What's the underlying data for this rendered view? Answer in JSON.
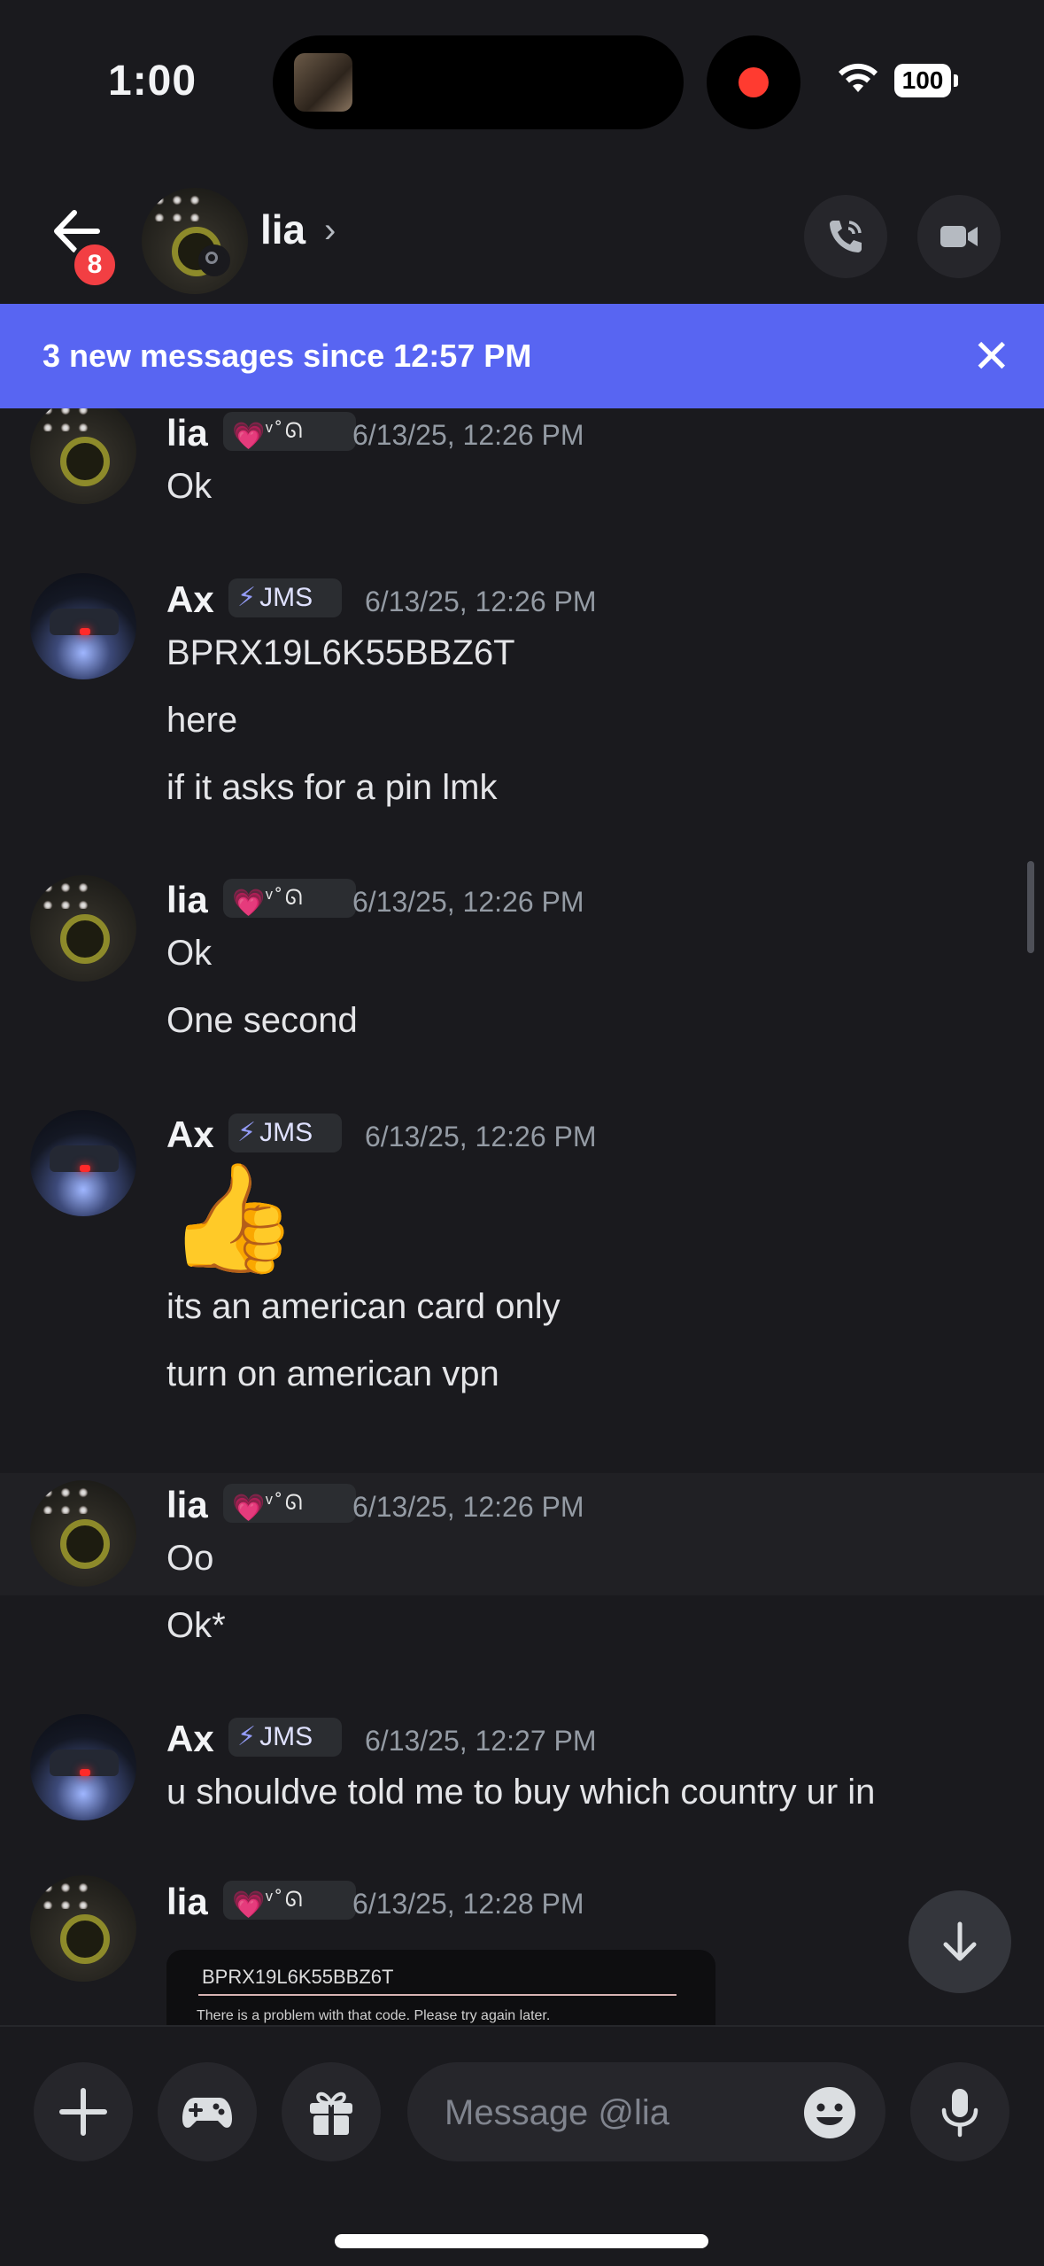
{
  "status_bar": {
    "time": "1:00",
    "battery": "100"
  },
  "header": {
    "back_badge": "8",
    "contact_name": "lia",
    "chevron": "›"
  },
  "banner": {
    "text": "3 new messages since 12:57 PM",
    "close": "✕"
  },
  "messages": [
    {
      "author": "lia",
      "tag_heart": "💗",
      "tag_deco": "ᵛ˚ᘏ",
      "timestamp": "6/13/25, 12:26 PM",
      "lines": [
        "Ok"
      ]
    },
    {
      "author": "Ax",
      "tag_bolt": "⚡",
      "tag_text": "JMS",
      "timestamp": "6/13/25, 12:26 PM",
      "lines": [
        "BPRX19L6K55BBZ6T",
        "here",
        "if it asks for a pin lmk"
      ]
    },
    {
      "author": "lia",
      "tag_heart": "💗",
      "tag_deco": "ᵛ˚ᘏ",
      "timestamp": "6/13/25, 12:26 PM",
      "lines": [
        "Ok",
        "One second"
      ]
    },
    {
      "author": "Ax",
      "tag_bolt": "⚡",
      "tag_text": "JMS",
      "timestamp": "6/13/25, 12:26 PM",
      "emoji": "👍",
      "lines": [
        "its an american card only",
        "turn on american vpn"
      ]
    },
    {
      "author": "lia",
      "tag_heart": "💗",
      "tag_deco": "ᵛ˚ᘏ",
      "timestamp": "6/13/25, 12:26 PM",
      "lines": [
        "Oo",
        "Ok*"
      ]
    },
    {
      "author": "Ax",
      "tag_bolt": "⚡",
      "tag_text": "JMS",
      "timestamp": "6/13/25, 12:27 PM",
      "lines": [
        "u shouldve told me to buy which country ur in"
      ]
    },
    {
      "author": "lia",
      "tag_heart": "💗",
      "tag_deco": "ᵛ˚ᘏ",
      "timestamp": "6/13/25, 12:28 PM",
      "attachment": {
        "code": "BPRX19L6K55BBZ6T",
        "error": "There is a problem with that code. Please try again later."
      }
    }
  ],
  "composer": {
    "placeholder": "Message @lia"
  },
  "colors": {
    "accent": "#5865f2",
    "background": "#1a1a1e",
    "badge": "#f23f43",
    "record": "#ff3b30"
  },
  "icons": [
    "back-arrow-icon",
    "phone-call-icon",
    "video-camera-icon",
    "close-icon",
    "plus-icon",
    "gamepad-icon",
    "gift-icon",
    "emoji-icon",
    "microphone-icon",
    "arrow-down-icon",
    "wifi-icon"
  ]
}
